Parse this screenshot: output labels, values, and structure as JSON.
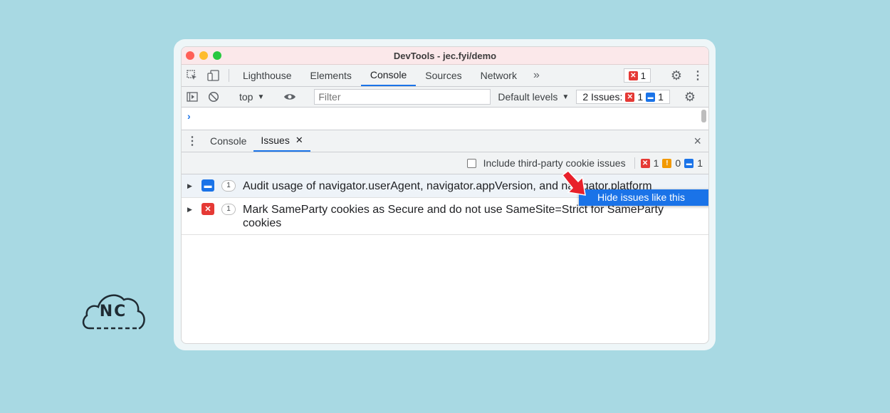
{
  "logo": {
    "text": "NC"
  },
  "window": {
    "title": "DevTools - jec.fyi/demo"
  },
  "tabs": {
    "items": [
      "Lighthouse",
      "Elements",
      "Console",
      "Sources",
      "Network"
    ],
    "active": "Console",
    "error_count": "1"
  },
  "toolbar": {
    "context": "top",
    "filter_placeholder": "Filter",
    "levels": "Default levels",
    "issues_label": "2 Issues:",
    "issues_errors": "1",
    "issues_info": "1"
  },
  "drawer": {
    "tabs": [
      "Console",
      "Issues"
    ],
    "active": "Issues",
    "close_symbol": "×"
  },
  "issues_toolbar": {
    "checkbox_label": "Include third-party cookie issues",
    "counts": {
      "errors": "1",
      "warnings": "0",
      "info": "1"
    }
  },
  "issues": [
    {
      "kind": "info",
      "count": "1",
      "text": "Audit usage of navigator.userAgent, navigator.appVersion, and navigator.platform"
    },
    {
      "kind": "error",
      "count": "1",
      "text": "Mark SameParty cookies as Secure and do not use SameSite=Strict for SameParty cookies"
    }
  ],
  "context_menu": {
    "item": "Hide issues like this"
  },
  "colors": {
    "accent": "#1a73e8",
    "error": "#e53935",
    "warning": "#f29900",
    "background": "#a8d9e3"
  }
}
